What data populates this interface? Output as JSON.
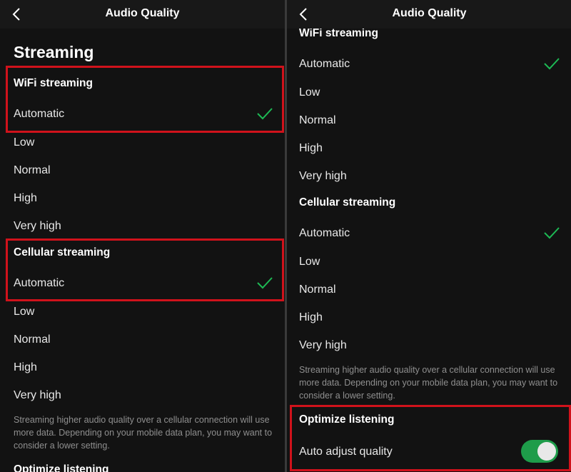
{
  "screens": [
    {
      "header": {
        "title": "Audio Quality",
        "back_icon": "chevron-left-icon"
      },
      "heading": "Streaming",
      "wifi": {
        "title": "WiFi streaming",
        "options": [
          {
            "label": "Automatic",
            "selected": true
          },
          {
            "label": "Low"
          },
          {
            "label": "Normal"
          },
          {
            "label": "High"
          },
          {
            "label": "Very high"
          }
        ]
      },
      "cellular": {
        "title": "Cellular streaming",
        "options": [
          {
            "label": "Automatic",
            "selected": true
          },
          {
            "label": "Low"
          },
          {
            "label": "Normal"
          },
          {
            "label": "High"
          },
          {
            "label": "Very high"
          }
        ]
      },
      "note": "Streaming higher audio quality over a cellular connection will use more data. Depending on your mobile data plan, you may want to consider a lower setting.",
      "optimize_title": "Optimize listening"
    },
    {
      "header": {
        "title": "Audio Quality",
        "back_icon": "chevron-left-icon"
      },
      "wifi": {
        "title": "WiFi streaming",
        "options": [
          {
            "label": "Automatic",
            "selected": true
          },
          {
            "label": "Low"
          },
          {
            "label": "Normal"
          },
          {
            "label": "High"
          },
          {
            "label": "Very high"
          }
        ]
      },
      "cellular": {
        "title": "Cellular streaming",
        "options": [
          {
            "label": "Automatic",
            "selected": true
          },
          {
            "label": "Low"
          },
          {
            "label": "Normal"
          },
          {
            "label": "High"
          },
          {
            "label": "Very high"
          }
        ]
      },
      "note": "Streaming higher audio quality over a cellular connection will use more data. Depending on your mobile data plan, you may want to consider a lower setting.",
      "optimize": {
        "title": "Optimize listening",
        "auto_adjust_label": "Auto adjust quality",
        "auto_adjust_on": true
      }
    }
  ],
  "colors": {
    "accent": "#1db954",
    "highlight": "#d0121b",
    "background": "#121212"
  }
}
